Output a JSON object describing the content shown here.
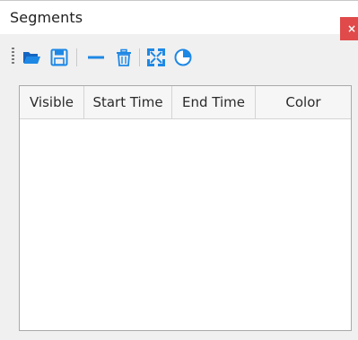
{
  "panel": {
    "title": "Segments",
    "close_glyph": "×"
  },
  "toolbar": {
    "buttons": [
      {
        "icon": "open-folder-icon",
        "color": "#1e88e5"
      },
      {
        "icon": "save-icon",
        "color": "#1e88e5"
      },
      {
        "icon": "remove-icon",
        "color": "#1e88e5"
      },
      {
        "icon": "delete-icon",
        "color": "#1e88e5"
      },
      {
        "icon": "fit-view-icon",
        "color": "#1e88e5"
      },
      {
        "icon": "color-wheel-icon",
        "color": "#1e88e5"
      }
    ]
  },
  "table": {
    "columns": [
      "Visible",
      "Start Time",
      "End Time",
      "Color"
    ],
    "rows": []
  },
  "colors": {
    "accent": "#1e88e5",
    "close_button": "#e04a4a"
  }
}
